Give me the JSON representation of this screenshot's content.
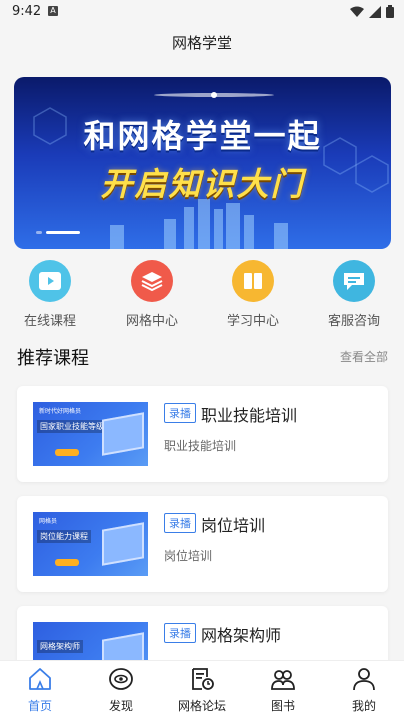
{
  "status": {
    "time": "9:42",
    "notification_glyph": "A"
  },
  "header": {
    "title": "网格学堂"
  },
  "banner": {
    "line1": "和网格学堂一起",
    "line2": "开启知识大门"
  },
  "quick_nav": [
    {
      "label": "在线课程",
      "icon": "play-icon",
      "color": "#4fc3e8"
    },
    {
      "label": "网格中心",
      "icon": "layers-icon",
      "color": "#f05a4a"
    },
    {
      "label": "学习中心",
      "icon": "book-icon",
      "color": "#f7b731"
    },
    {
      "label": "客服咨询",
      "icon": "chat-icon",
      "color": "#3fb6e0"
    }
  ],
  "section": {
    "title": "推荐课程",
    "more": "查看全部"
  },
  "courses": [
    {
      "tag": "录播",
      "title": "职业技能培训",
      "subtitle": "职业技能培训",
      "thumb_small": "新时代好网格员",
      "thumb_text": "国家职业技能等级鉴定"
    },
    {
      "tag": "录播",
      "title": "岗位培训",
      "subtitle": "岗位培训",
      "thumb_small": "网格员",
      "thumb_text": "岗位能力课程"
    },
    {
      "tag": "录播",
      "title": "网格架构师",
      "subtitle": "",
      "thumb_small": "",
      "thumb_text": "网格架构师"
    }
  ],
  "tabbar": [
    {
      "label": "首页",
      "icon": "home-icon",
      "active": true
    },
    {
      "label": "发现",
      "icon": "eye-icon",
      "active": false
    },
    {
      "label": "网格论坛",
      "icon": "forum-icon",
      "active": false
    },
    {
      "label": "图书",
      "icon": "books-icon",
      "active": false
    },
    {
      "label": "我的",
      "icon": "profile-icon",
      "active": false
    }
  ],
  "colors": {
    "accent": "#3a7ee8",
    "background": "#f5f5f5"
  }
}
